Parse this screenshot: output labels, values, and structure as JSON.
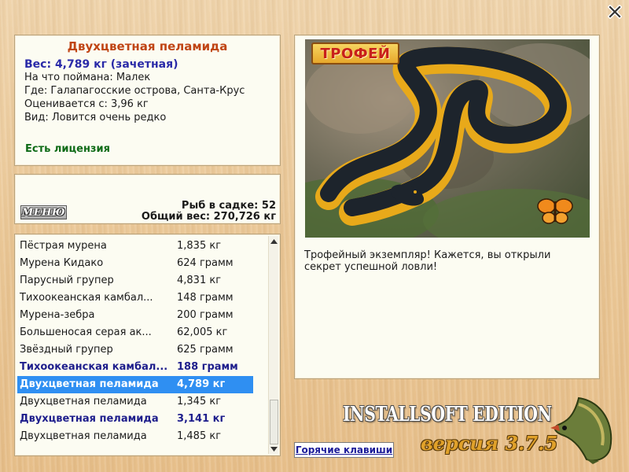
{
  "close_label": "X",
  "fish": {
    "title": "Двухцветная пеламида",
    "weight": "Вес: 4,789 кг (зачетная)",
    "bait": "На что поймана: Малек",
    "location": "Где: Галапагосские острова, Санта-Крус",
    "rated_from": "Оценивается с: 3,96 кг",
    "kind": "Вид: Ловится очень редко",
    "license": "Есть лицензия"
  },
  "stats": {
    "menu_label": "МЕНЮ",
    "fish_count": "Рыб в садке: 52",
    "total_weight": "Общий вес: 270,726 кг"
  },
  "catch_list": [
    {
      "name": "Пёстрая мурена",
      "weight": "1,835 кг",
      "style": "normal"
    },
    {
      "name": "Мурена Кидако",
      "weight": "624 грамм",
      "style": "normal"
    },
    {
      "name": "Парусный групер",
      "weight": "4,831 кг",
      "style": "normal"
    },
    {
      "name": "Тихоокеанская камбал...",
      "weight": "148 грамм",
      "style": "normal"
    },
    {
      "name": "Мурена-зебра",
      "weight": "200 грамм",
      "style": "normal"
    },
    {
      "name": "Большеносая серая ак...",
      "weight": "62,005 кг",
      "style": "normal"
    },
    {
      "name": "Звёздный групер",
      "weight": "625 грамм",
      "style": "normal"
    },
    {
      "name": "Тихоокеанская камбал...",
      "weight": "188 грамм",
      "style": "bold"
    },
    {
      "name": "Двухцветная пеламида",
      "weight": "4,789 кг",
      "style": "selected"
    },
    {
      "name": "Двухцветная пеламида",
      "weight": "1,345 кг",
      "style": "normal"
    },
    {
      "name": "Двухцветная пеламида",
      "weight": "3,141 кг",
      "style": "bold"
    },
    {
      "name": "Двухцветная пеламида",
      "weight": "1,485 кг",
      "style": "normal"
    }
  ],
  "trophy": {
    "badge": "ТРОФЕЙ",
    "description": "Трофейный экземпляр! Кажется, вы открыли секрет успешной ловли!"
  },
  "hotkeys_label": "Горячие клавиши",
  "brand": {
    "edition": "INSTALLSOFT EDITION",
    "version": "версия 3.7.5"
  },
  "colors": {
    "title": "#c04515",
    "weight": "#2a2aa8",
    "license": "#0f6b17",
    "selected_row": "#2f8ff2",
    "bold_row": "#1e1e8c"
  }
}
